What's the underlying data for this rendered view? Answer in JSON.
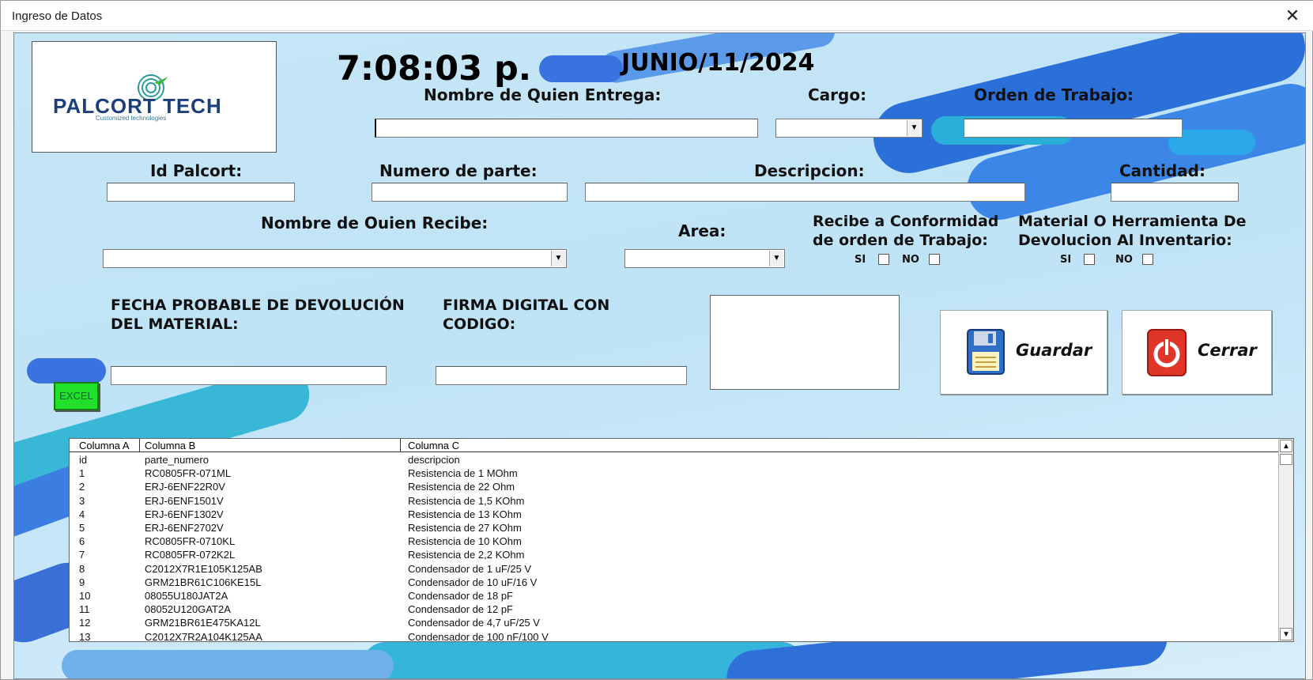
{
  "window": {
    "title": "Ingreso de Datos"
  },
  "header": {
    "time": "7:08:03 p.",
    "date": "JUNIO/11/2024"
  },
  "logo": {
    "brand": "PALCORT TECH",
    "tagline": "Customized technologies"
  },
  "labels": {
    "entrega": "Nombre de Quien Entrega:",
    "cargo": "Cargo:",
    "orden": "Orden de Trabajo:",
    "id_palcort": "Id Palcort:",
    "numero_parte": "Numero de parte:",
    "descripcion": "Descripcion:",
    "cantidad": "Cantidad:",
    "recibe": "Nombre de Ouien Recibe:",
    "area": "Area:",
    "conformidad_1": "Recibe a Conformidad",
    "conformidad_2": "de orden de Trabajo:",
    "devolucion_1": "Material O Herramienta De",
    "devolucion_2": "Devolucion Al Inventario:",
    "fecha_1": "FECHA PROBABLE DE DEVOLUCIÓN",
    "fecha_2": "DEL MATERIAL:",
    "firma_1": "FIRMA DIGITAL CON",
    "firma_2": "CODIGO:",
    "si": "SI",
    "no": "NO"
  },
  "fields": {
    "entrega": "",
    "cargo": "",
    "orden": "",
    "id_palcort": "",
    "numero_parte": "",
    "descripcion": "",
    "cantidad": "",
    "recibe": "",
    "area": "",
    "fecha": "",
    "firma": ""
  },
  "buttons": {
    "guardar": "Guardar",
    "cerrar": "Cerrar",
    "excel": "EXCEL"
  },
  "colors": {
    "form_bg": "#c6e6f6",
    "accent_blue": "#3a7de0",
    "excel_green": "#22e02a",
    "cerrar_red": "#e0362a"
  },
  "list": {
    "columns": [
      "Columna A",
      "Columna B",
      "Columna C"
    ],
    "rows": [
      [
        "id",
        "parte_numero",
        "descripcion"
      ],
      [
        "1",
        "RC0805FR-071ML",
        "Resistencia de 1 MOhm"
      ],
      [
        "2",
        "ERJ-6ENF22R0V",
        "Resistencia de 22 Ohm"
      ],
      [
        "3",
        "ERJ-6ENF1501V",
        "Resistencia de 1,5 KOhm"
      ],
      [
        "4",
        "ERJ-6ENF1302V",
        "Resistencia de 13 KOhm"
      ],
      [
        "5",
        "ERJ-6ENF2702V",
        "Resistencia de 27 KOhm"
      ],
      [
        "6",
        "RC0805FR-0710KL",
        "Resistencia de 10 KOhm"
      ],
      [
        "7",
        "RC0805FR-072K2L",
        "Resistencia de 2,2 KOhm"
      ],
      [
        "8",
        "C2012X7R1E105K125AB",
        "Condensador de 1 uF/25 V"
      ],
      [
        "9",
        "GRM21BR61C106KE15L",
        "Condensador de 10 uF/16 V"
      ],
      [
        "10",
        "08055U180JAT2A",
        "Condensador de 18 pF"
      ],
      [
        "11",
        "08052U120GAT2A",
        "Condensador de 12 pF"
      ],
      [
        "12",
        "GRM21BR61E475KA12L",
        "Condensador de 4,7 uF/25 V"
      ],
      [
        "13",
        "C2012X7R2A104K125AA",
        "Condensador de 100 nF/100 V"
      ]
    ]
  }
}
